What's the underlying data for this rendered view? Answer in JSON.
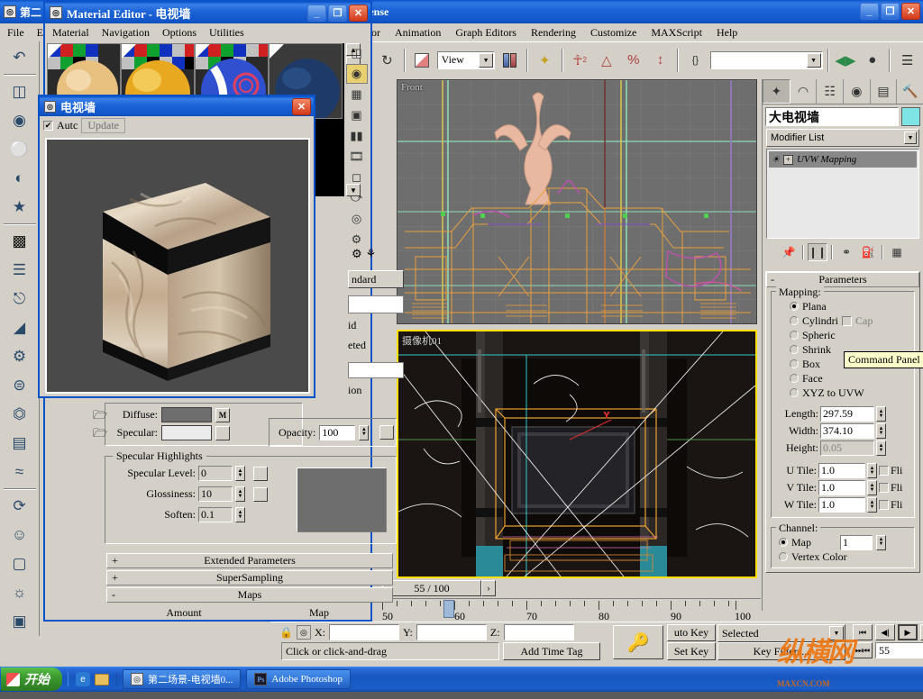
{
  "background_window": {
    "title": "第二",
    "menu": [
      "File",
      "E"
    ]
  },
  "max_window": {
    "title": "cense",
    "menu": [
      "or",
      "Animation",
      "Graph Editors",
      "Rendering",
      "Customize",
      "MAXScript",
      "Help"
    ],
    "win_buttons": {
      "minimize": "_",
      "maximize": "❐",
      "close": "✕"
    },
    "toolbar": {
      "undo_icon": "undo-icon",
      "select_link_icon": "select-link-icon",
      "ref_coord_value": "View",
      "align_icon": "align-icon",
      "snap_toggle_icon": "snap-toggle-icon",
      "angle_snap_icon": "angle-snap-icon",
      "percent_snap_icon": "percent-snap-icon",
      "spinner_snap_icon": "spinner-snap-icon",
      "named_sets_icon": "named-selection-sets-icon",
      "named_sets_value": "",
      "mirror_icon": "mirror-icon",
      "material_editor_icon": "material-editor-icon",
      "layers_icon": "layer-manager-icon"
    }
  },
  "left_toolbar": {
    "icons": [
      "undo-curve-icon",
      "box-primitives-icon",
      "torus-icon",
      "sphere-wire-icon",
      "lathe-icon",
      "star-shape-icon",
      "chamfer-box-icon",
      "helix-coil-icon",
      "bend-icon",
      "taper-icon",
      "gear-icon",
      "skeleton-icon",
      "flatten-icon",
      "shatter-icon",
      "wave-icon",
      "twist-icon",
      "biped-icon",
      "cloth-icon",
      "light-icon",
      "camera-icon"
    ]
  },
  "viewports": [
    {
      "label": "Front",
      "active": false
    },
    {
      "label": "摄像机01",
      "active": true
    }
  ],
  "command_panel": {
    "tabs": [
      {
        "name": "create-tab",
        "icon": "arrow-star-icon",
        "active": true
      },
      {
        "name": "modify-tab",
        "icon": "bend-arc-icon",
        "active": false
      },
      {
        "name": "hierarchy-tab",
        "icon": "hierarchy-tree-icon",
        "active": false
      },
      {
        "name": "motion-tab",
        "icon": "motion-wheel-icon",
        "active": false
      },
      {
        "name": "display-tab",
        "icon": "display-monitor-icon",
        "active": false
      },
      {
        "name": "utilities-tab",
        "icon": "hammer-icon",
        "active": false
      }
    ],
    "object_name": "大电视墙",
    "object_color": "#7fe4e4",
    "modifier_list_label": "Modifier List",
    "stack": [
      {
        "name": "UVW Mapping",
        "enabled": true
      }
    ],
    "stack_tools": [
      "pin-stack-icon",
      "show-end-result-icon",
      "make-unique-icon",
      "remove-modifier-icon",
      "configure-sets-icon"
    ],
    "rollouts": [
      {
        "title": "Parameters",
        "expanded": true,
        "groups": [
          {
            "title": "Mapping:",
            "radios": [
              {
                "label": "Plana",
                "selected": true
              },
              {
                "label": "Cylindri",
                "selected": false,
                "sub_check": {
                  "label": "Cap",
                  "checked": false
                }
              },
              {
                "label": "Spheric",
                "selected": false
              },
              {
                "label": "Shrink",
                "selected": false
              },
              {
                "label": "Box",
                "selected": false
              },
              {
                "label": "Face",
                "selected": false
              },
              {
                "label": "XYZ to UVW",
                "selected": false
              }
            ],
            "fields": [
              {
                "label": "Length:",
                "value": "297.59",
                "disabled": false
              },
              {
                "label": "Width:",
                "value": "374.10",
                "disabled": false
              },
              {
                "label": "Height:",
                "value": "0.05",
                "disabled": true
              },
              {
                "label": "U Tile:",
                "value": "1.0",
                "disabled": false,
                "flip": {
                  "label": "Fli",
                  "checked": false
                }
              },
              {
                "label": "V Tile:",
                "value": "1.0",
                "disabled": false,
                "flip": {
                  "label": "Fli",
                  "checked": false
                }
              },
              {
                "label": "W Tile:",
                "value": "1.0",
                "disabled": false,
                "flip": {
                  "label": "Fli",
                  "checked": false
                }
              }
            ]
          },
          {
            "title": "Channel:",
            "radios": [
              {
                "label": "Map",
                "selected": true,
                "value": "1"
              },
              {
                "label": "Vertex Color",
                "selected": false
              }
            ]
          }
        ]
      }
    ],
    "tooltip": "Command Panel"
  },
  "material_editor": {
    "title": "Material Editor - 电视墙",
    "menu": [
      "Material",
      "Navigation",
      "Options",
      "Utilities"
    ],
    "win_buttons": {
      "minimize": "_",
      "maximize": "❐",
      "close": "✕"
    },
    "vertical_tools": [
      "sample-type-icon",
      "backlight-icon",
      "background-checker-icon",
      "sample-uv-tiling-icon",
      "video-color-check-icon",
      "make-preview-icon",
      "options-icon",
      "select-by-material-icon",
      "material-id-channel-icon",
      "show-end-result-icon"
    ],
    "type_button": "ndard",
    "shader_labels": [
      "id",
      "eted"
    ],
    "basic_params": {
      "diffuse_label": "Diffuse:",
      "diffuse_color": "#6e6e6e",
      "diffuse_map_btn": "M",
      "specular_label": "Specular:",
      "specular_color": "#ebebeb",
      "opacity_label": "Opacity:",
      "opacity_value": "100"
    },
    "specular_highlights": {
      "title": "Specular Highlights",
      "fields": [
        {
          "label": "Specular Level:",
          "value": "0"
        },
        {
          "label": "Glossiness:",
          "value": "10"
        },
        {
          "label": "Soften:",
          "value": "0.1"
        }
      ]
    },
    "rollouts": [
      {
        "label": "Extended Parameters",
        "pm": "+"
      },
      {
        "label": "SuperSampling",
        "pm": "+"
      },
      {
        "label": "Maps",
        "pm": "-"
      }
    ],
    "maps_headers": [
      "Amount",
      "Map"
    ]
  },
  "preview_window": {
    "title": "电视墙",
    "close_label": "✕",
    "auto_label": "Autc",
    "auto_checked": true,
    "update_label": "Update"
  },
  "time_slider": {
    "current_label": "55 / 100",
    "next_arrow": "›",
    "ruler_ticks": [
      50,
      60,
      70,
      80,
      90,
      100
    ],
    "handle_frame": 55
  },
  "status_bar": {
    "lock_icon": "lock-selection-icon",
    "abs_rel_icon": "absolute-mode-icon",
    "x_label": "X:",
    "x_value": "",
    "y_label": "Y:",
    "y_value": "",
    "z_label": "Z:",
    "z_value": "",
    "key_icon": "key-mode-icon",
    "prompt": "Click or click-and-drag",
    "add_time_tag": "Add Time Tag",
    "auto_key": "uto Key",
    "set_key": "Set Key",
    "selected_dropdown": "Selected",
    "key_filters": "Key Filters...",
    "frame_field": "55",
    "playback_icons": [
      "go-to-start-icon",
      "previous-frame-icon",
      "play-animation-icon",
      "next-frame-icon",
      "go-to-end-icon",
      "key-mode-toggle-icon"
    ],
    "nav_icons": [
      "zoom-icon",
      "zoom-all-icon",
      "zoom-extents-icon",
      "zoom-region-icon",
      "pan-icon",
      "arc-rotate-icon",
      "max-viewport-toggle-icon",
      "field-of-view-icon"
    ]
  },
  "taskbar": {
    "start_label": "开始",
    "quick_launch": [
      "ie-icon",
      "folder-icon"
    ],
    "items": [
      {
        "icon": "max-icon",
        "label": "第二场景-电视墙0..."
      },
      {
        "icon": "photoshop-icon",
        "label": "Adobe Photoshop"
      }
    ]
  },
  "watermark": {
    "text": "纵横网",
    "sub": "MAXCN.COM"
  }
}
